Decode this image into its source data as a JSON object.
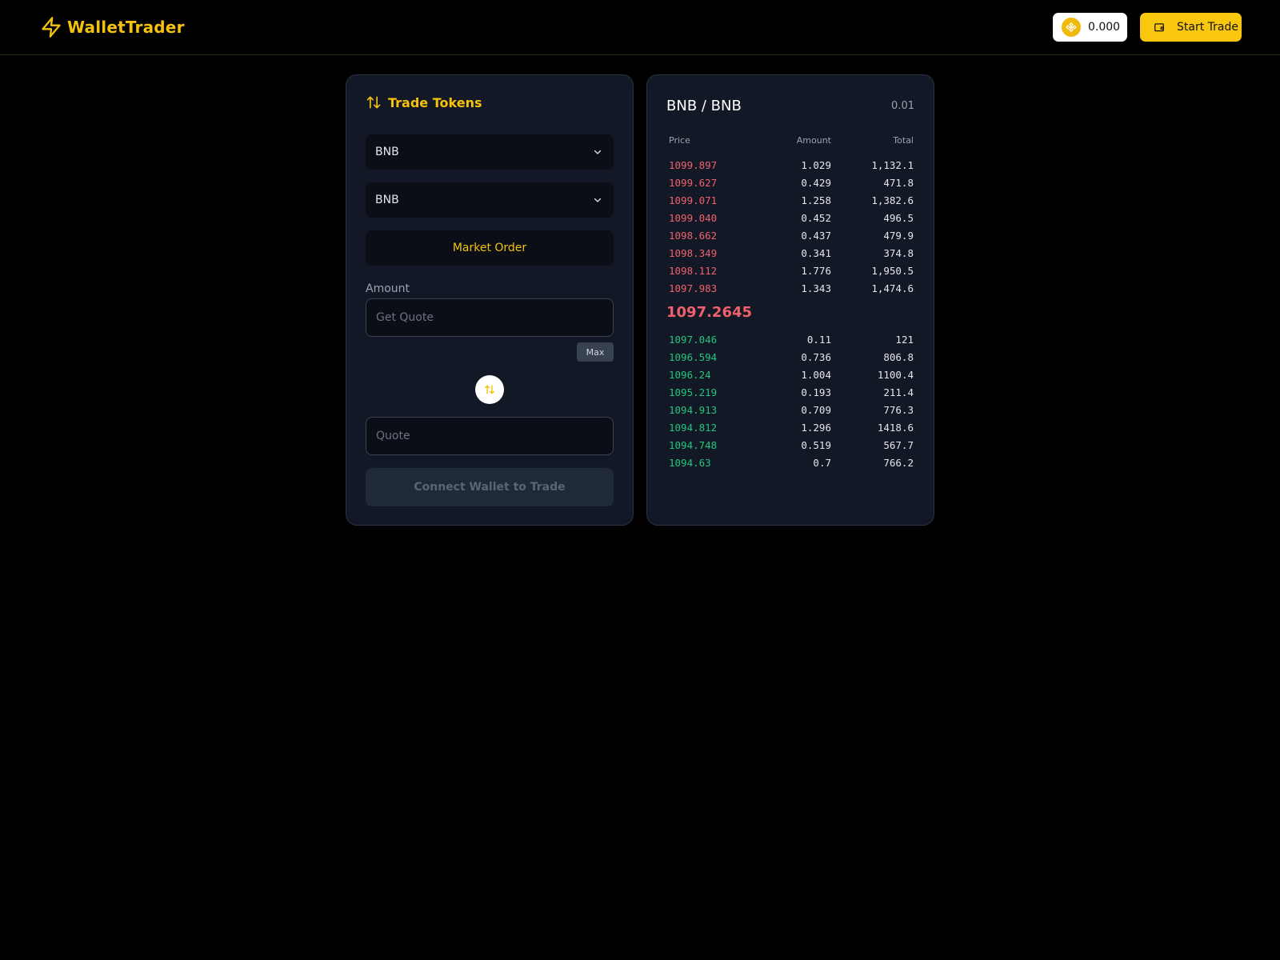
{
  "header": {
    "brand": "WalletTrader",
    "balance": "0.000",
    "start_label": "Start Trade",
    "accent": "#f4c20d"
  },
  "trade": {
    "title": "Trade Tokens",
    "from_token": "BNB",
    "to_token": "BNB",
    "order_type": "Market Order",
    "amount_label": "Amount",
    "amount_placeholder": "Get Quote",
    "max_label": "Max",
    "quote_placeholder": "Quote",
    "connect_label": "Connect Wallet to Trade"
  },
  "orderbook": {
    "pair": "BNB / BNB",
    "tick": "0.01",
    "headers": {
      "price": "Price",
      "amount": "Amount",
      "total": "Total"
    },
    "asks": [
      {
        "price": "1099.897",
        "amount": "1.029",
        "total": "1,132.1"
      },
      {
        "price": "1099.627",
        "amount": "0.429",
        "total": "471.8"
      },
      {
        "price": "1099.071",
        "amount": "1.258",
        "total": "1,382.6"
      },
      {
        "price": "1099.040",
        "amount": "0.452",
        "total": "496.5"
      },
      {
        "price": "1098.662",
        "amount": "0.437",
        "total": "479.9"
      },
      {
        "price": "1098.349",
        "amount": "0.341",
        "total": "374.8"
      },
      {
        "price": "1098.112",
        "amount": "1.776",
        "total": "1,950.5"
      },
      {
        "price": "1097.983",
        "amount": "1.343",
        "total": "1,474.6"
      }
    ],
    "mid_price": "1097.2645",
    "bids": [
      {
        "price": "1097.046",
        "amount": "0.11",
        "total": "121"
      },
      {
        "price": "1096.594",
        "amount": "0.736",
        "total": "806.8"
      },
      {
        "price": "1096.24",
        "amount": "1.004",
        "total": "1100.4"
      },
      {
        "price": "1095.219",
        "amount": "0.193",
        "total": "211.4"
      },
      {
        "price": "1094.913",
        "amount": "0.709",
        "total": "776.3"
      },
      {
        "price": "1094.812",
        "amount": "1.296",
        "total": "1418.6"
      },
      {
        "price": "1094.748",
        "amount": "0.519",
        "total": "567.7"
      },
      {
        "price": "1094.63",
        "amount": "0.7",
        "total": "766.2"
      }
    ],
    "ask_color": "#f0616d",
    "bid_color": "#22c57e"
  }
}
